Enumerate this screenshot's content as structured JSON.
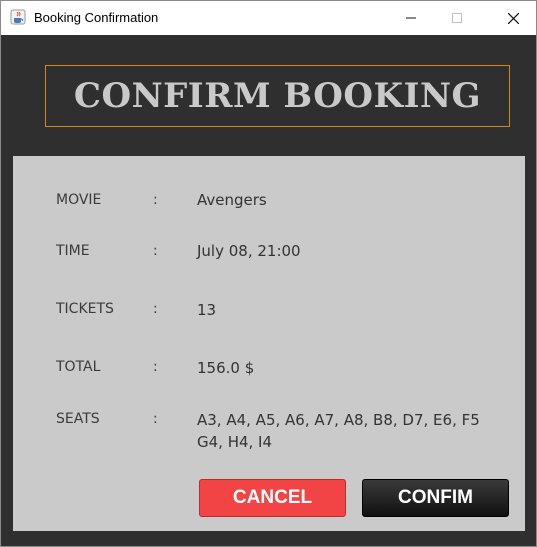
{
  "window": {
    "title": "Booking Confirmation"
  },
  "header": {
    "title": "CONFIRM BOOKING"
  },
  "details": [
    {
      "label": "MOVIE",
      "colon": ":",
      "value": "Avengers"
    },
    {
      "label": "TIME",
      "colon": ":",
      "value": "July 08, 21:00"
    },
    {
      "label": "TICKETS",
      "colon": ":",
      "value": "13"
    },
    {
      "label": "TOTAL",
      "colon": ":",
      "value": "156.0 $"
    },
    {
      "label": "SEATS",
      "colon": ":",
      "value_line1": "A3, A4, A5, A6, A7, A8, B8, D7, E6, F5",
      "value_line2": "G4, H4, I4"
    }
  ],
  "buttons": {
    "cancel": "CANCEL",
    "confirm": "CONFIM"
  },
  "colors": {
    "cancel": "#f24445",
    "confirm": "#1c1c1c",
    "accent_border": "#d18a16",
    "panel": "#cacaca",
    "frame": "#2f2f2f"
  },
  "icons": {
    "app": "java-cup-icon",
    "minimize": "minimize-icon",
    "maximize": "maximize-icon",
    "close": "close-icon"
  }
}
